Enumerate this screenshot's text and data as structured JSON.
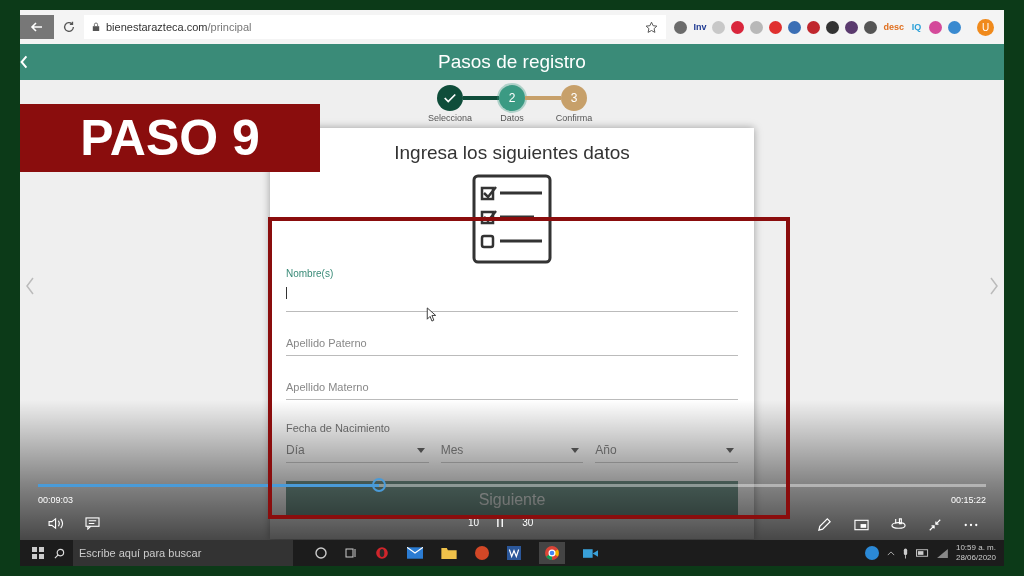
{
  "browser": {
    "url_host": "bienestarazteca.com",
    "url_path": "/principal",
    "extensions": [
      {
        "color": "#6b6b6b"
      },
      {
        "label": "Inv",
        "color": "#1f3a93"
      },
      {
        "color": "#c8c8c8"
      },
      {
        "color": "#d9263c"
      },
      {
        "color": "#b8b8b8"
      },
      {
        "color": "#e0302f"
      },
      {
        "color": "#3b6fb5"
      },
      {
        "color": "#c0272d"
      },
      {
        "color": "#333333"
      },
      {
        "color": "#5a3a6e"
      },
      {
        "color": "#555555"
      },
      {
        "label": "desc",
        "color": "#e07020"
      },
      {
        "label": "IQ",
        "color": "#2aa0d8"
      },
      {
        "color": "#d44a9a"
      },
      {
        "color": "#3a8ad0"
      }
    ],
    "profile": "U"
  },
  "page": {
    "header": "Pasos de registro",
    "steps": [
      {
        "label": "Selecciona",
        "done": true,
        "selected": false
      },
      {
        "label": "Datos",
        "number": "2",
        "done": false,
        "selected": true
      },
      {
        "label": "Confirma",
        "number": "3",
        "done": false,
        "selected": false
      }
    ],
    "form": {
      "title": "Ingresa los siguientes datos",
      "fields": [
        {
          "label": "Nombre(s)",
          "focused": true
        },
        {
          "label": "Apellido Paterno",
          "focused": false
        },
        {
          "label": "Apellido Materno",
          "focused": false
        }
      ],
      "date_label": "Fecha de Nacimiento",
      "selects": [
        "Día",
        "Mes",
        "Año"
      ],
      "submit": {
        "label": "Siguiente",
        "disabled": true
      }
    }
  },
  "annotation": {
    "banner": "PASO 9"
  },
  "video_player": {
    "elapsed": "00:09:03",
    "total": "00:15:22",
    "progress": {
      "level": 0.36
    },
    "skip_back": "10",
    "skip_forward": "30"
  },
  "taskbar": {
    "search_placeholder": "Escribe aquí para buscar",
    "time": "10:59 a. m.",
    "date": "28/06/2020"
  }
}
